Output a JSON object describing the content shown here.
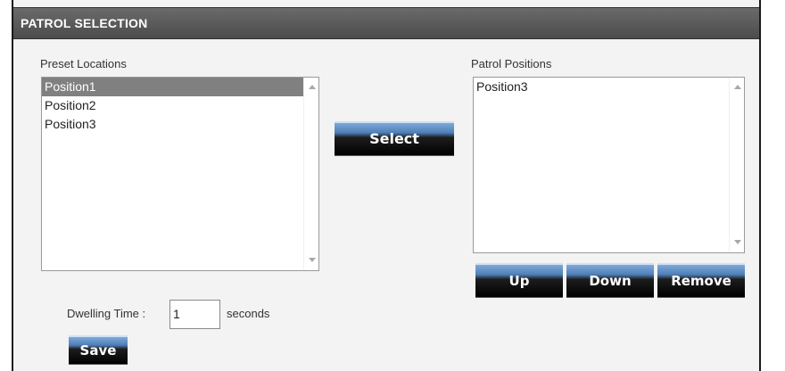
{
  "title": "PATROL SELECTION",
  "preset": {
    "label": "Preset Locations",
    "items": [
      {
        "label": "Position1",
        "selected": true
      },
      {
        "label": "Position2",
        "selected": false
      },
      {
        "label": "Position3",
        "selected": false
      }
    ]
  },
  "patrol": {
    "label": "Patrol Positions",
    "items": [
      {
        "label": "Position3",
        "selected": false
      }
    ]
  },
  "buttons": {
    "select": "Select",
    "up": "Up",
    "down": "Down",
    "remove": "Remove",
    "save": "Save"
  },
  "dwelling": {
    "label": "Dwelling Time :",
    "value": "1",
    "unit": "seconds"
  },
  "colors": {
    "titlebar": "#555555",
    "selection": "#808080",
    "button_top": "#7fa9d8",
    "button_bottom": "#000000"
  }
}
